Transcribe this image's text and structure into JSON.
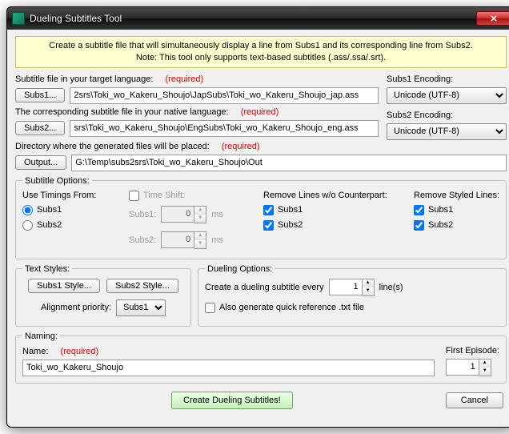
{
  "titlebar": {
    "title": "Dueling Subtitles Tool"
  },
  "banner": {
    "line1": "Create a subtitle file that will simultaneously display a line from Subs1 and its corresponding line from Subs2.",
    "line2": "Note: This tool only supports text-based subtitles (.ass/.ssa/.srt)."
  },
  "files": {
    "target_label": "Subtitle file in your target language:",
    "native_label": "The corresponding subtitle file in your native language:",
    "output_label": "Directory where the generated files will be placed:",
    "required": "(required)",
    "subs1_btn": "Subs1...",
    "subs2_btn": "Subs2...",
    "output_btn": "Output...",
    "subs1_path": "2srs\\Toki_wo_Kakeru_Shoujo\\JapSubs\\Toki_wo_Kakeru_Shoujo_jap.ass",
    "subs2_path": "srs\\Toki_wo_Kakeru_Shoujo\\EngSubs\\Toki_wo_Kakeru_Shoujo_eng.ass",
    "output_path": "G:\\Temp\\subs2srs\\Toki_wo_Kakeru_Shoujo\\Out"
  },
  "encoding": {
    "subs1_label": "Subs1 Encoding:",
    "subs2_label": "Subs2 Encoding:",
    "value": "Unicode (UTF-8)"
  },
  "options": {
    "legend": "Subtitle Options:",
    "timings_header": "Use Timings From:",
    "subs1": "Subs1",
    "subs2": "Subs2",
    "timeshift_header": "Time Shift:",
    "subs1_shift": "0",
    "subs2_shift": "0",
    "ms": "ms",
    "subs1_lbl": "Subs1:",
    "subs2_lbl": "Subs2:",
    "remove_header": "Remove Lines w/o Counterpart:",
    "styled_header": "Remove Styled Lines:"
  },
  "styles": {
    "legend": "Text Styles:",
    "subs1_btn": "Subs1 Style...",
    "subs2_btn": "Subs2 Style...",
    "align_label": "Alignment priority:",
    "align_val": "Subs1"
  },
  "dueling": {
    "legend": "Dueling Options:",
    "every_pre": "Create a dueling subtitle every",
    "every_val": "1",
    "every_post": "line(s)",
    "quickref": "Also generate quick reference .txt file"
  },
  "naming": {
    "legend": "Naming:",
    "name_label": "Name:",
    "required": "(required)",
    "name_val": "Toki_wo_Kakeru_Shoujo",
    "first_ep_label": "First Episode:",
    "first_ep_val": "1"
  },
  "buttons": {
    "create": "Create Dueling Subtitles!",
    "cancel": "Cancel"
  }
}
